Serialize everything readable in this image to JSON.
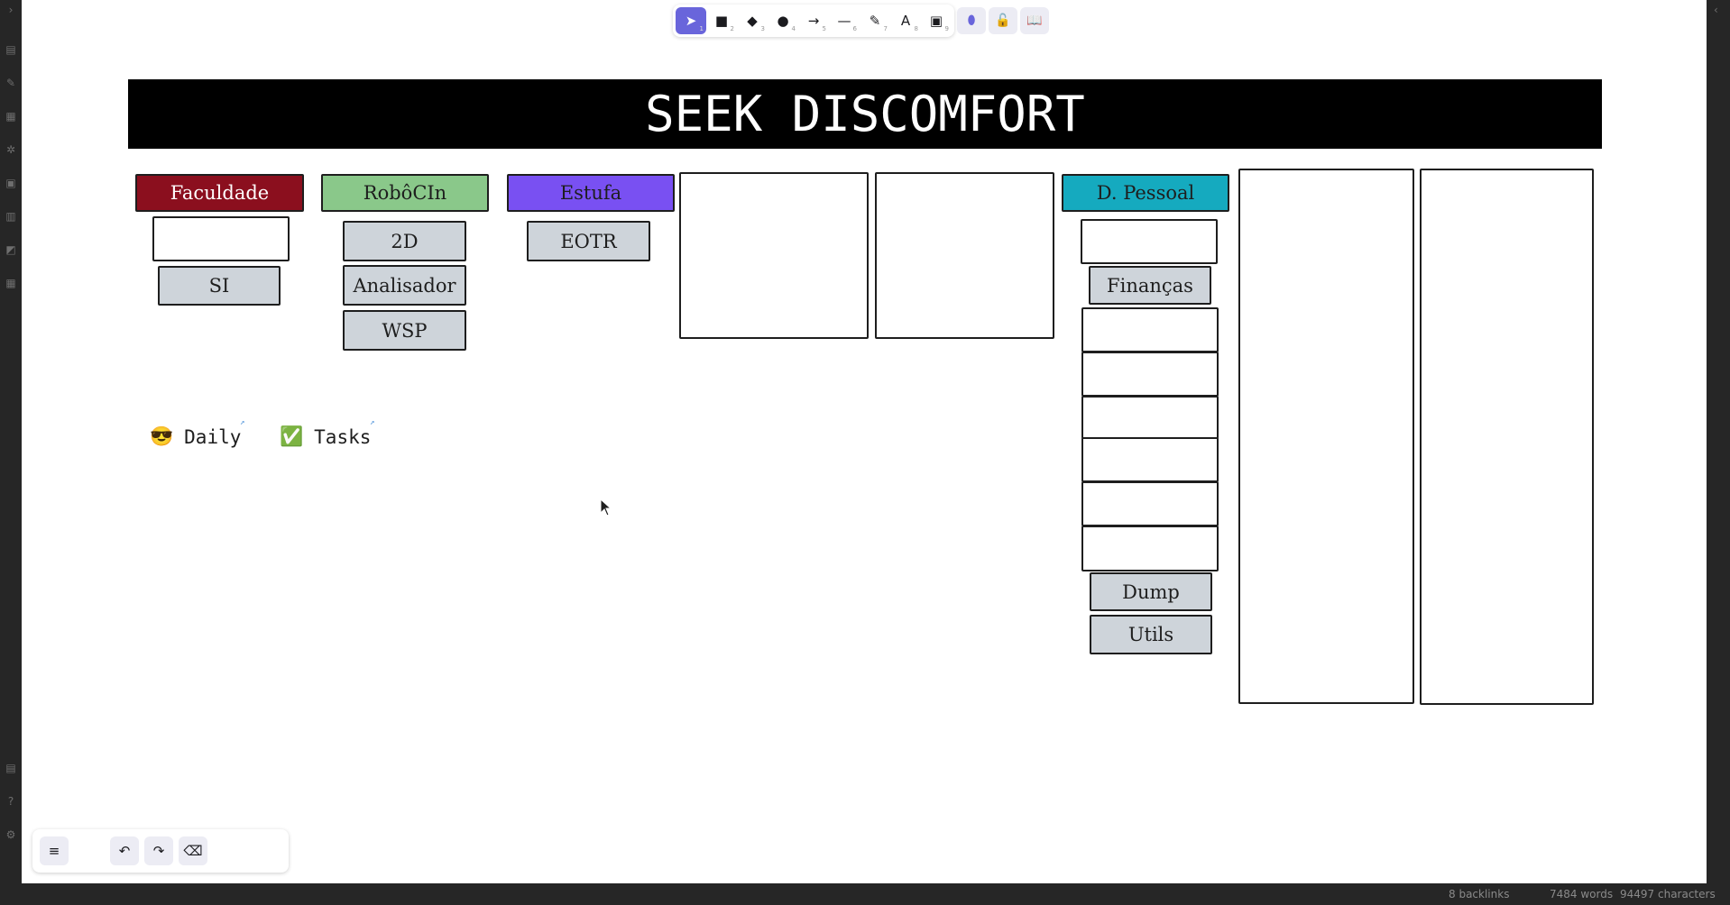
{
  "ribbon": {
    "icons": [
      "files-icon",
      "bookmark-icon",
      "canvas-icon",
      "graph-icon",
      "calendar-icon",
      "template-icon",
      "publish-icon",
      "daily-note-icon"
    ],
    "bottom_icons": [
      "vault-icon",
      "help-icon",
      "settings-icon"
    ]
  },
  "toolbar": {
    "tools": [
      {
        "name": "selection",
        "glyph": "➤",
        "key": "1"
      },
      {
        "name": "rectangle",
        "glyph": "■",
        "key": "2"
      },
      {
        "name": "diamond",
        "glyph": "◆",
        "key": "3"
      },
      {
        "name": "ellipse",
        "glyph": "●",
        "key": "4"
      },
      {
        "name": "arrow",
        "glyph": "→",
        "key": "5"
      },
      {
        "name": "line",
        "glyph": "—",
        "key": "6"
      },
      {
        "name": "draw",
        "glyph": "✎",
        "key": "7"
      },
      {
        "name": "text",
        "glyph": "A",
        "key": "8"
      },
      {
        "name": "image",
        "glyph": "▣",
        "key": "9"
      }
    ],
    "extra": [
      {
        "name": "obsidian-tools",
        "glyph": "⬮"
      },
      {
        "name": "lock",
        "glyph": "🔓"
      },
      {
        "name": "library",
        "glyph": "📖"
      }
    ]
  },
  "board": {
    "title": "SEEK DISCOMFORT",
    "headers": {
      "faculdade": "Faculdade",
      "robocin": "RobôCIn",
      "estufa": "Estufa",
      "pessoal": "D. Pessoal"
    },
    "cards": {
      "si": "SI",
      "2d": "2D",
      "analisador": "Analisador",
      "wsp": "WSP",
      "eotr": "EOTR",
      "financas": "Finanças",
      "dump": "Dump",
      "utils": "Utils"
    }
  },
  "links": {
    "daily": {
      "emoji": "😎",
      "label": "Daily"
    },
    "tasks": {
      "emoji": "✅",
      "label": "Tasks"
    }
  },
  "bottom_controls": {
    "menu": "≡",
    "undo": "↶",
    "redo": "↷",
    "eraser": "⌫"
  },
  "statusbar": {
    "backlinks": "8 backlinks",
    "words": "7484 words",
    "characters": "94497 characters"
  }
}
